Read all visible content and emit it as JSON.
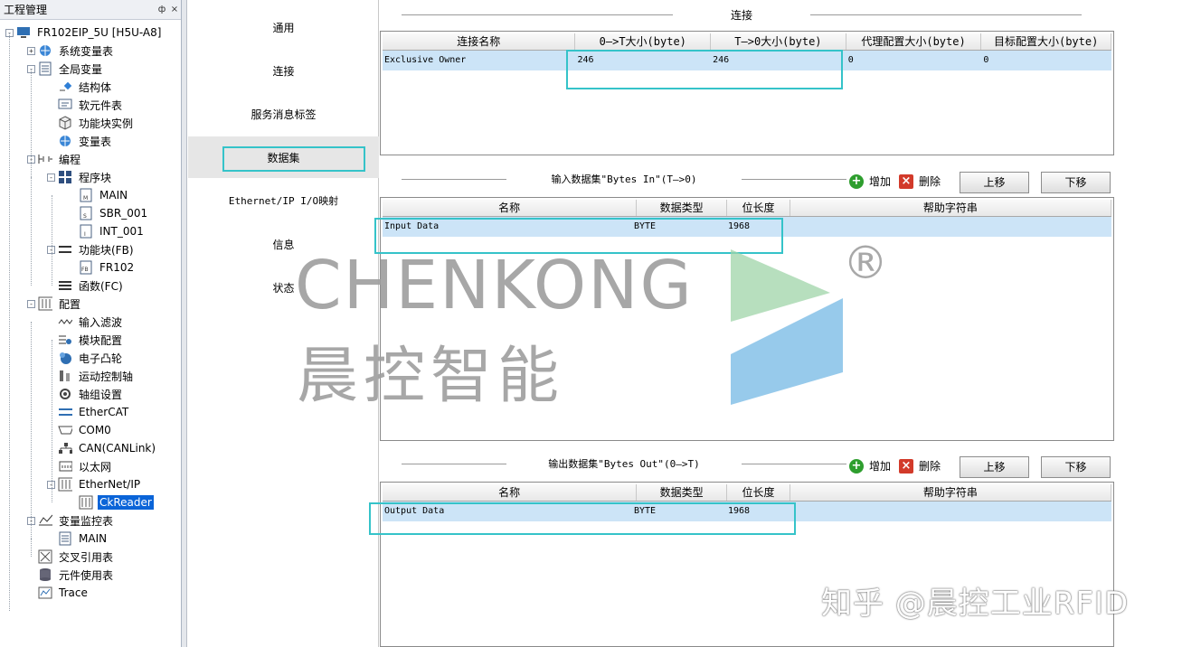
{
  "project_panel": {
    "title": "工程管理",
    "pin_glyph": "ф",
    "close_glyph": "×",
    "tree": [
      {
        "label": "FR102EIP_5U [H5U-A8]",
        "icon": "plc-computer-icon"
      },
      {
        "label": "系统变量表",
        "icon": "globe-variable-icon"
      },
      {
        "label": "全局变量",
        "icon": "table-icon"
      },
      {
        "label": "结构体",
        "icon": "struct-icon"
      },
      {
        "label": "软元件表",
        "icon": "comment-table-icon"
      },
      {
        "label": "功能块实例",
        "icon": "cube-icon"
      },
      {
        "label": "变量表",
        "icon": "globe-variable-icon"
      },
      {
        "label": "编程",
        "icon": "ladder-icon"
      },
      {
        "label": "程序块",
        "icon": "blocks-icon"
      },
      {
        "label": "MAIN",
        "icon": "program-main-icon"
      },
      {
        "label": "SBR_001",
        "icon": "program-sbr-icon"
      },
      {
        "label": "INT_001",
        "icon": "program-int-icon"
      },
      {
        "label": "功能块(FB)",
        "icon": "fb-group-icon"
      },
      {
        "label": "FR102",
        "icon": "fb-icon"
      },
      {
        "label": "函数(FC)",
        "icon": "fc-icon"
      },
      {
        "label": "配置",
        "icon": "config-icon"
      },
      {
        "label": "输入滤波",
        "icon": "filter-wave-icon"
      },
      {
        "label": "模块配置",
        "icon": "module-config-icon"
      },
      {
        "label": "电子凸轮",
        "icon": "cam-icon"
      },
      {
        "label": "运动控制轴",
        "icon": "axis-icon"
      },
      {
        "label": "轴组设置",
        "icon": "gear-group-icon"
      },
      {
        "label": "EtherCAT",
        "icon": "ethercat-icon"
      },
      {
        "label": "COM0",
        "icon": "serial-port-icon"
      },
      {
        "label": "CAN(CANLink)",
        "icon": "can-network-icon"
      },
      {
        "label": "以太网",
        "icon": "ethernet-icon"
      },
      {
        "label": "EtherNet/IP",
        "icon": "config-icon"
      },
      {
        "label": "CkReader",
        "icon": "device-icon"
      },
      {
        "label": "变量监控表",
        "icon": "monitor-icon"
      },
      {
        "label": "MAIN",
        "icon": "table-icon"
      },
      {
        "label": "交叉引用表",
        "icon": "cross-ref-icon"
      },
      {
        "label": "元件使用表",
        "icon": "database-icon"
      },
      {
        "label": "Trace",
        "icon": "trace-icon"
      }
    ]
  },
  "nav": {
    "items": [
      {
        "label": "通用"
      },
      {
        "label": "连接"
      },
      {
        "label": "服务消息标签"
      },
      {
        "label": "数据集"
      },
      {
        "label": "Ethernet/IP I/O映射"
      },
      {
        "label": "信息"
      },
      {
        "label": "状态"
      }
    ],
    "active_index": 3
  },
  "connection": {
    "title": "连接",
    "columns": [
      "连接名称",
      "0—>T大小(byte)",
      "T—>0大小(byte)",
      "代理配置大小(byte)",
      "目标配置大小(byte)"
    ],
    "rows": [
      [
        "Exclusive Owner",
        "246",
        "246",
        "0",
        "0"
      ]
    ]
  },
  "input_dataset": {
    "title": "输入数据集\"Bytes In\"(T—>0)",
    "add_label": "增加",
    "delete_label": "删除",
    "up_label": "上移",
    "down_label": "下移",
    "columns": [
      "名称",
      "数据类型",
      "位长度",
      "帮助字符串"
    ],
    "rows": [
      [
        "Input Data",
        "BYTE",
        "1968",
        ""
      ]
    ]
  },
  "output_dataset": {
    "title": "输出数据集\"Bytes Out\"(0—>T)",
    "add_label": "增加",
    "delete_label": "删除",
    "up_label": "上移",
    "down_label": "下移",
    "columns": [
      "名称",
      "数据类型",
      "位长度",
      "帮助字符串"
    ],
    "rows": [
      [
        "Output Data",
        "BYTE",
        "1968",
        ""
      ]
    ]
  },
  "watermark": {
    "brand": "CHENKONG",
    "brand_cn": "晨控智能",
    "registered": "®",
    "source": "知乎 @晨控工业RFID"
  },
  "colors": {
    "selection_row": "#cce4f7",
    "highlight_box": "#35c3c9",
    "tree_selected": "#0a64d8",
    "add_icon": "#2e9e2e",
    "delete_icon": "#d23a2a"
  }
}
